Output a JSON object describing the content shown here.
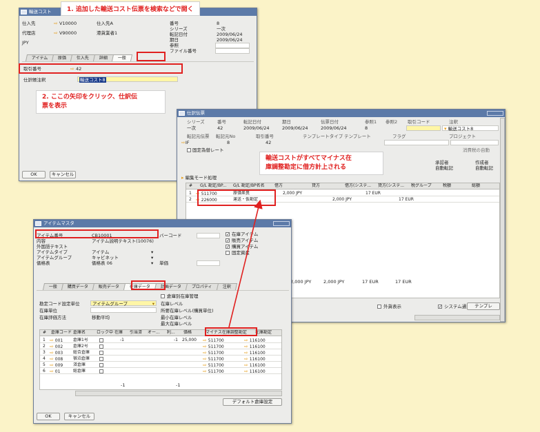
{
  "callouts": {
    "c1": "1. 追加した輸送コスト伝票を検索などで開く",
    "c2a": "2. ここの矢印をクリック、仕訳伝",
    "c2b": "票を表示",
    "c3a": "輸送コストがすべてマイナス在",
    "c3b": "庫調整勘定に借方計上される"
  },
  "w1": {
    "title": "輸送コスト",
    "vendor_l": "仕入先",
    "vendor_code": "V10000",
    "vendor_name": "仕入先A",
    "agent_l": "代理店",
    "agent_code": "V90000",
    "agent_name": "港貨業者1",
    "currency": "JPY",
    "num_l": "番号",
    "num": "8",
    "series_l": "シリーズ",
    "series": "一次",
    "posting_l": "転記日付",
    "posting": "2009/06/24",
    "due_l": "期日",
    "due": "2009/06/24",
    "ref_l": "参照",
    "file_l": "ファイル番号",
    "tabs": [
      "アイテム",
      "原価",
      "仕入先",
      "詳細",
      "一般"
    ],
    "je_l": "取引番号",
    "je_num": "42",
    "jv_l": "仕訳帳注釈",
    "jv": "輸送コスト8",
    "ok": "OK",
    "cancel": "キャンセル"
  },
  "w2": {
    "title": "仕訳伝票",
    "h": [
      "シリーズ",
      "番号",
      "転記日付",
      "期日",
      "伝票日付",
      "参照1",
      "参照2",
      "取引コード",
      "注釈"
    ],
    "v": [
      "一次",
      "42",
      "2009/06/24",
      "2009/06/24",
      "2009/06/24",
      "8",
      "",
      "",
      "輸送コスト8"
    ],
    "h2": [
      "転記元伝票",
      "転記元No",
      "取引番号",
      "テンプレートタイプ",
      "テンプレート",
      "フラグ",
      "プロジェクト"
    ],
    "v2": [
      "IF",
      "8",
      "42"
    ],
    "fixed": "固定為替レート",
    "cancelled": "消費税の自動",
    "approver_l": "承認者",
    "approver": "自動転記",
    "creator_l": "作成者",
    "creator": "自動転記",
    "mode": "編集モード処理",
    "cols": [
      "#",
      "G/L 勘定/BP...",
      "G/L 勘定/BP名名",
      "借方",
      "貸方",
      "借方(システ...",
      "貸方(システ...",
      "税グループ",
      "税額",
      "総額"
    ],
    "rows": [
      [
        "1",
        "511700",
        "原価差異",
        "2,000 JPY",
        "",
        "17 EUR",
        "",
        "",
        ""
      ],
      [
        "2",
        "226000",
        "運送・仮勘定",
        "",
        "2,000 JPY",
        "",
        "17 EUR",
        "",
        ""
      ]
    ],
    "tot": [
      "2,000 JPY",
      "2,000 JPY",
      "17 EUR",
      "17 EUR"
    ],
    "foreign": "外貨表示",
    "sys": "システム通貨表示",
    "tmpl": "テンプレ"
  },
  "w3": {
    "title": "アイテムマスタ",
    "item_l": "アイテム番号",
    "item": "CB10001",
    "desc_l": "内容",
    "desc": "アイテム説明テキスト(10076)",
    "foreign_l": "外国語テキスト",
    "type_l": "アイテムタイプ",
    "type": "アイテム",
    "group_l": "アイテムグループ",
    "group": "キャビネット",
    "price_l": "価格表",
    "price": "価格表 06",
    "unit_l": "単価",
    "barcode_l": "バーコード",
    "chks": [
      "在庫アイテム",
      "販売アイテム",
      "購買アイテム",
      "固定資産"
    ],
    "tabs": [
      "一般",
      "購買データ",
      "販売データ",
      "在庫データ",
      "計画データ",
      "プロパティ",
      "注釈"
    ],
    "bywh": "倉庫別在庫管理",
    "glset_l": "勘定コード設定単位",
    "glset": "アイテムグループ",
    "unit2_l": "在庫単位",
    "val_l": "在庫評価方法",
    "val": "移動平均",
    "lv1": "在庫レベル",
    "lv2": "所要在庫レベル(購買単位)",
    "lv3": "最小在庫レベル",
    "lv4": "最大在庫レベル",
    "cols": [
      "#",
      "倉庫コード",
      "倉庫名",
      "ロック中",
      "在庫",
      "引当済",
      "オー...",
      "利...",
      "価格",
      "マイナス在庫調整勘定",
      "在庫勘定"
    ],
    "rows": [
      [
        "1",
        "001",
        "倉庫1号",
        "-1",
        "",
        "",
        "-1",
        "25,000",
        "511700",
        "116100"
      ],
      [
        "2",
        "002",
        "倉庫2号",
        "",
        "",
        "",
        "",
        "",
        "511700",
        "116100"
      ],
      [
        "3",
        "003",
        "総合倉庫",
        "",
        "",
        "",
        "",
        "",
        "511700",
        "116100"
      ],
      [
        "4",
        "008",
        "宿泊倉庫",
        "",
        "",
        "",
        "",
        "",
        "511700",
        "116100"
      ],
      [
        "5",
        "009",
        "済倉庫",
        "",
        "",
        "",
        "",
        "",
        "511700",
        "116100"
      ],
      [
        "6",
        "01",
        "総倉庫",
        "",
        "",
        "",
        "",
        "",
        "511700",
        "116100"
      ]
    ],
    "sum1": "-1",
    "sum2": "-1",
    "default_wh": "デフォルト倉庫設定",
    "ok": "OK",
    "cancel": "キャンセル"
  }
}
